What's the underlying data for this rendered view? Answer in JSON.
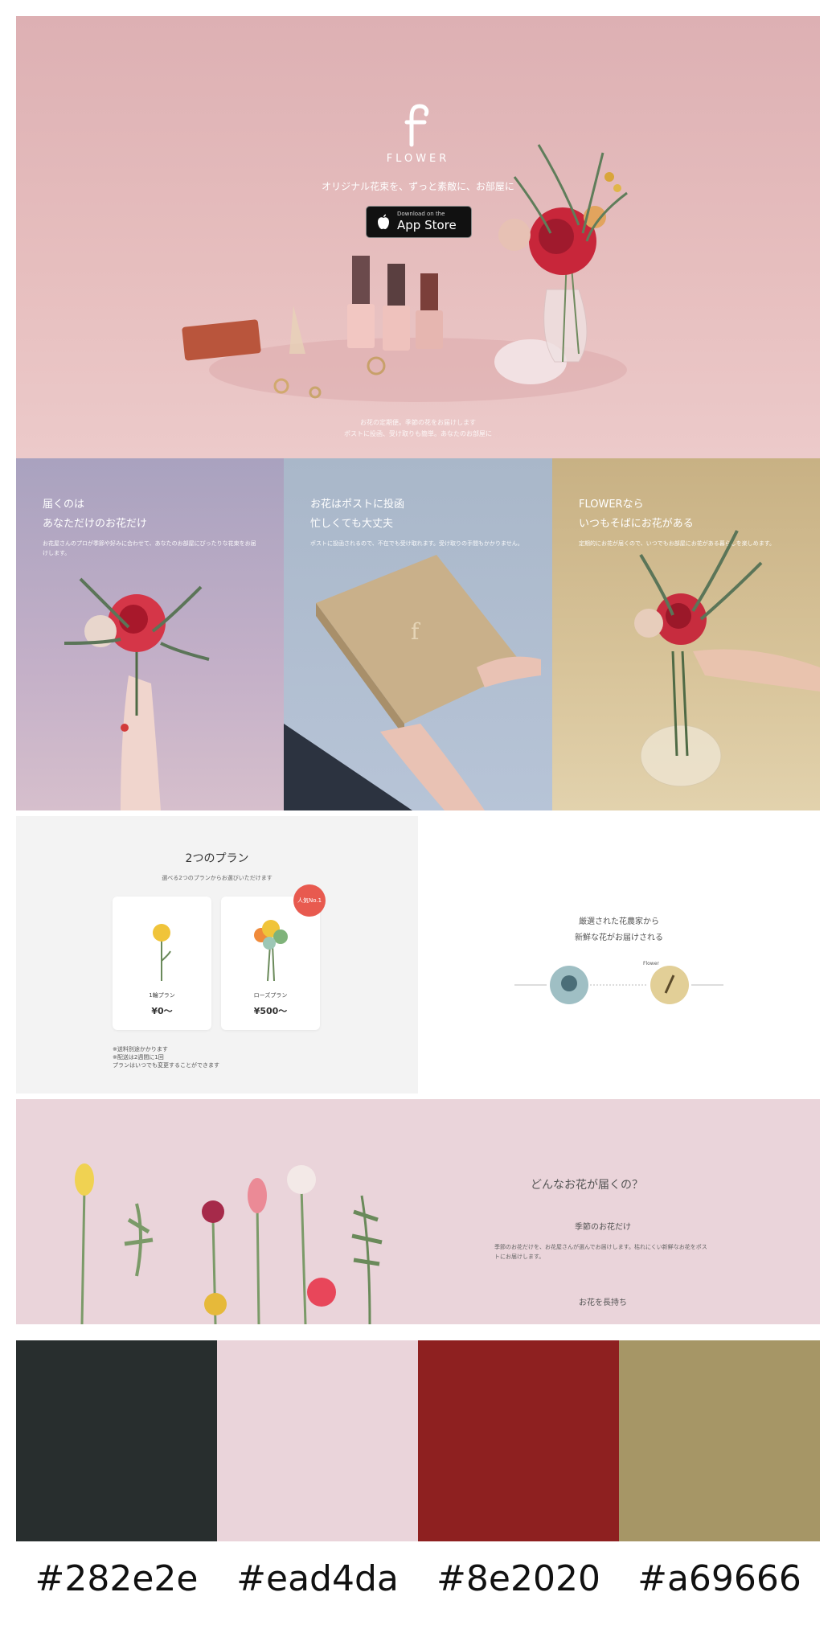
{
  "hero": {
    "brand": "FLOWER",
    "tagline": "オリジナル花束を、ずっと素敵に、お部屋に",
    "app_store": {
      "small": "Download on the",
      "large": "App Store"
    },
    "note_line1": "お花の定期便。季節の花をお届けします",
    "note_line2": "ポストに投函、受け取りも簡単。あなたのお部屋に"
  },
  "features": [
    {
      "title_line1": "届くのは",
      "title_line2": "あなただけのお花だけ",
      "text": "お花屋さんのプロが季節や好みに合わせて、あなたのお部屋にぴったりな花束をお届けします。"
    },
    {
      "title_line1": "お花はポストに投函",
      "title_line2": "忙しくても大丈夫",
      "text": "ポストに投函されるので、不在でも受け取れます。受け取りの手間もかかりません。"
    },
    {
      "title_line1": "FLOWERなら",
      "title_line2": "いつもそばにお花がある",
      "text": "定期的にお花が届くので、いつでもお部屋にお花がある暮らしを楽しめます。"
    }
  ],
  "plans": {
    "title": "2つのプラン",
    "subtitle": "選べる2つのプランからお選びいただけます",
    "badge": "人気No.1",
    "cards": [
      {
        "name": "1輪プラン",
        "price": "¥0〜"
      },
      {
        "name": "ローズプラン",
        "price": "¥500〜"
      }
    ],
    "notes": [
      "※送料別途かかります",
      "※配送は2週間に1回",
      "プランはいつでも変更することができます"
    ]
  },
  "flow": {
    "title_line1": "厳選された花農家から",
    "title_line2": "新鮮な花がお届けされる",
    "arrow_label": "Flower"
  },
  "content": {
    "title": "どんなお花が届くの？",
    "section1_title": "季節のお花だけ",
    "section1_text": "季節のお花だけを、お花屋さんが選んでお届けします。枯れにくい新鮮なお花をポストにお届けします。",
    "section2_title": "お花を長持ち"
  },
  "palette": [
    {
      "hex": "#282e2e",
      "color": "#282e2e"
    },
    {
      "hex": "#ead4da",
      "color": "#ead4da"
    },
    {
      "hex": "#8e2020",
      "color": "#8e2020"
    },
    {
      "hex": "#a69666",
      "color": "#a69666"
    }
  ]
}
